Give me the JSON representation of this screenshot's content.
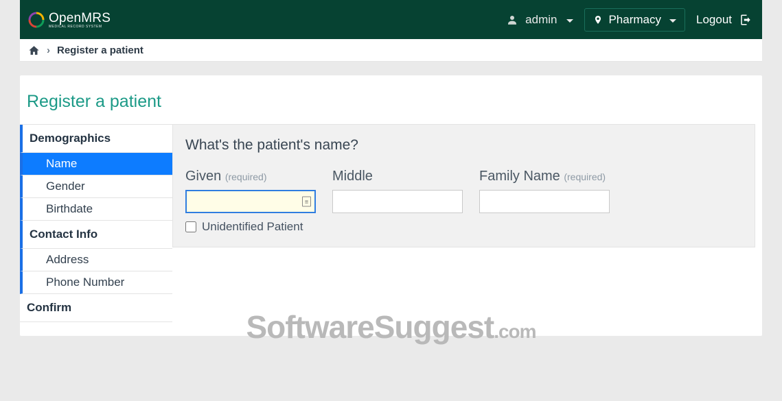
{
  "brand": {
    "name": "OpenMRS",
    "tagline": "MEDICAL RECORD SYSTEM"
  },
  "header": {
    "user": "admin",
    "location": "Pharmacy",
    "logout": "Logout"
  },
  "breadcrumb": {
    "current": "Register a patient"
  },
  "page": {
    "title": "Register a patient"
  },
  "sidebar": {
    "sections": [
      {
        "title": "Demographics",
        "steps": [
          {
            "label": "Name",
            "active": true
          },
          {
            "label": "Gender",
            "active": false
          },
          {
            "label": "Birthdate",
            "active": false
          }
        ]
      },
      {
        "title": "Contact Info",
        "steps": [
          {
            "label": "Address",
            "active": false
          },
          {
            "label": "Phone Number",
            "active": false
          }
        ]
      }
    ],
    "confirm": "Confirm"
  },
  "form": {
    "question": "What's the patient's name?",
    "required_label": "(required)",
    "fields": {
      "given": {
        "label": "Given",
        "required": true,
        "value": ""
      },
      "middle": {
        "label": "Middle",
        "required": false,
        "value": ""
      },
      "family": {
        "label": "Family Name",
        "required": true,
        "value": ""
      }
    },
    "unidentified": {
      "label": "Unidentified Patient",
      "checked": false
    }
  },
  "watermark": {
    "main": "SoftwareSuggest",
    "suffix": ".com"
  }
}
